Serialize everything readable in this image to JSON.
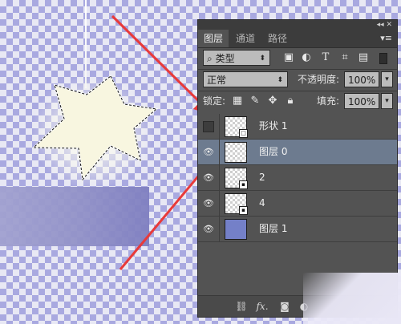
{
  "tabs": [
    {
      "label": "图层",
      "active": true
    },
    {
      "label": "通道",
      "active": false
    },
    {
      "label": "路径",
      "active": false
    }
  ],
  "filter": {
    "kind_label": "类型",
    "icons": [
      "image-filter-icon",
      "adjustment-filter-icon",
      "type-filter-icon",
      "shape-filter-icon",
      "smart-object-filter-icon"
    ]
  },
  "blend": {
    "mode": "正常",
    "opacity_label": "不透明度:",
    "opacity_value": "100%"
  },
  "lock": {
    "label": "锁定:",
    "icons": [
      "lock-transparent-icon",
      "lock-paint-icon",
      "lock-move-icon",
      "lock-all-icon"
    ],
    "fill_label": "填充:",
    "fill_value": "100%"
  },
  "layers": [
    {
      "name": "形状 1",
      "visible": false,
      "thumb": "shape",
      "selected": false
    },
    {
      "name": "图层 0",
      "visible": true,
      "thumb": "transparent",
      "selected": true
    },
    {
      "name": "2",
      "visible": true,
      "thumb": "smart",
      "selected": false
    },
    {
      "name": "4",
      "visible": true,
      "thumb": "smart",
      "selected": false
    },
    {
      "name": "图层 1",
      "visible": true,
      "thumb": "solid",
      "selected": false
    }
  ],
  "bottom_bar": {
    "icons": [
      "link-icon",
      "fx-icon",
      "mask-icon",
      "adjustment-icon"
    ],
    "fx_label": "fx."
  },
  "colors": {
    "panel_bg": "#535353",
    "selected_row": "#6d7b8f",
    "arrow": "#e83a3a",
    "layer1_thumb": "#7480c8"
  }
}
